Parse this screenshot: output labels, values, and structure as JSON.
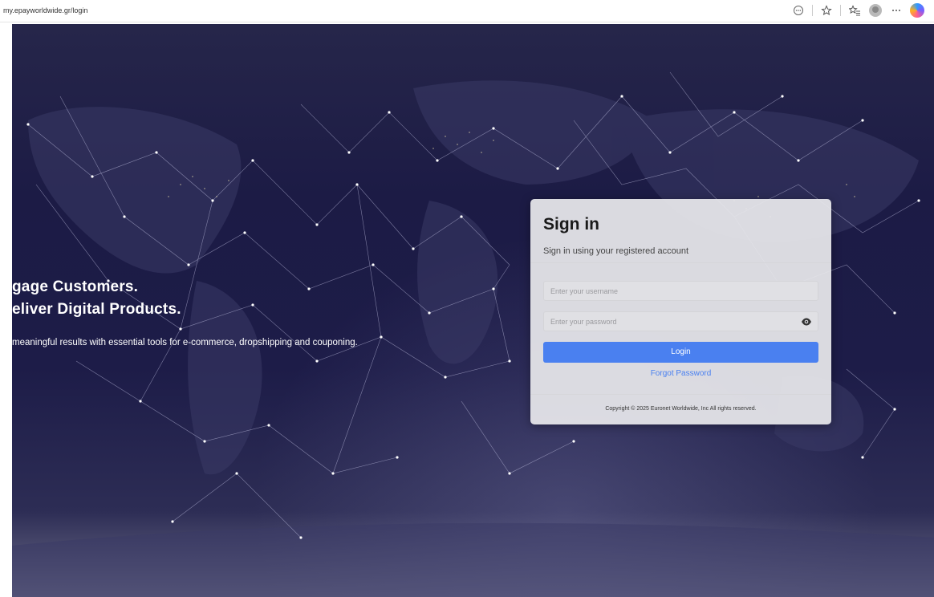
{
  "browser": {
    "url": "my.epayworldwide.gr/login",
    "icons": [
      "more-options-icon",
      "favorite-star-icon",
      "favorites-list-icon",
      "profile-avatar-icon",
      "ellipsis-icon",
      "copilot-icon"
    ]
  },
  "hero": {
    "line1": "gage Customers.",
    "line2": "eliver Digital Products.",
    "subtitle": "meaningful results with essential tools for e-commerce, dropshipping and couponing."
  },
  "signin": {
    "title": "Sign in",
    "subtitle": "Sign in using your registered account",
    "username_placeholder": "Enter your username",
    "password_placeholder": "Enter your password",
    "login_label": "Login",
    "forgot_label": "Forgot Password",
    "copyright": "Copyright © 2025 Euronet Worldwide, Inc All rights reserved."
  },
  "colors": {
    "primary": "#4a80f0",
    "background": "#1d1c48",
    "card": "#e8e8ec"
  }
}
